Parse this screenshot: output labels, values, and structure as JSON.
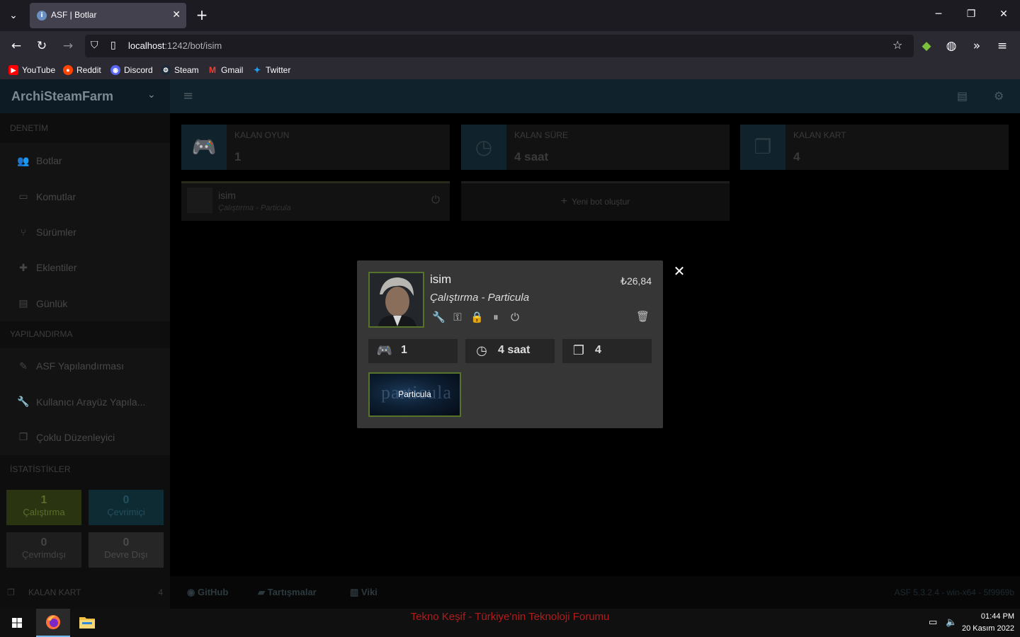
{
  "browser": {
    "tab_title": "ASF | Botlar",
    "url_host": "localhost",
    "url_rest": ":1242/bot/isim",
    "bookmarks": [
      {
        "label": "YouTube",
        "color": "#ff0000"
      },
      {
        "label": "Reddit",
        "color": "#ff4500"
      },
      {
        "label": "Discord",
        "color": "#5865f2"
      },
      {
        "label": "Steam",
        "color": "#1b2838"
      },
      {
        "label": "Gmail",
        "color": "#ea4335"
      },
      {
        "label": "Twitter",
        "color": "#1da1f2"
      }
    ]
  },
  "app": {
    "brand": "ArchiSteamFarm",
    "sidebar": {
      "section_control": "DENETİM",
      "control_items": [
        {
          "label": "Botlar",
          "icon": "users-icon"
        },
        {
          "label": "Komutlar",
          "icon": "laptop-icon"
        },
        {
          "label": "Sürümler",
          "icon": "branch-icon"
        },
        {
          "label": "Eklentiler",
          "icon": "puzzle-icon"
        },
        {
          "label": "Günlük",
          "icon": "file-icon"
        }
      ],
      "section_config": "YAPILANDIRMA",
      "config_items": [
        {
          "label": "ASF Yapılandırması",
          "icon": "edit-icon"
        },
        {
          "label": "Kullanıcı Arayüz Yapıla...",
          "icon": "wrench-icon"
        },
        {
          "label": "Çoklu Düzenleyici",
          "icon": "copy-icon"
        }
      ],
      "section_stats": "İSTATİSTİKLER",
      "stats": [
        {
          "num": "1",
          "label": "Çalıştırma",
          "color": "#2a3411"
        },
        {
          "num": "0",
          "label": "Çevrimiçi",
          "color": "#0e2a33"
        },
        {
          "num": "0",
          "label": "Çevrimdışı",
          "color": "#1e1e1e"
        },
        {
          "num": "0",
          "label": "Devre Dışı",
          "color": "#262626"
        }
      ],
      "bottom_label": "KALAN KART",
      "bottom_value": "4"
    },
    "info_boxes": [
      {
        "label": "KALAN OYUN",
        "value": "1",
        "icon": "gamepad-icon"
      },
      {
        "label": "KALAN SÜRE",
        "value": "4 saat",
        "icon": "clock-icon"
      },
      {
        "label": "KALAN KART",
        "value": "4",
        "icon": "cards-icon"
      }
    ],
    "bot_card": {
      "name": "isim",
      "status": "Çalıştırma - Particula"
    },
    "new_bot_label": "Yeni bot oluştur",
    "footer": {
      "links": [
        "GitHub",
        "Tartışmalar",
        "Viki"
      ],
      "version": "ASF 5.3.2.4 - win-x64 - 5f9969b"
    }
  },
  "modal": {
    "bot_name": "isim",
    "status": "Çalıştırma - Particula",
    "balance": "₺26,84",
    "stats": [
      {
        "value": "1",
        "icon": "gamepad-icon"
      },
      {
        "value": "4 saat",
        "icon": "clock-icon"
      },
      {
        "value": "4",
        "icon": "cards-icon"
      }
    ],
    "game": {
      "name": "Particula",
      "logo_text": "particula"
    }
  },
  "taskbar": {
    "center_text": "Tekno Keşif - Türkiye'nin Teknoloji Forumu",
    "time": "01:44 PM",
    "date": "20 Kasım 2022"
  }
}
